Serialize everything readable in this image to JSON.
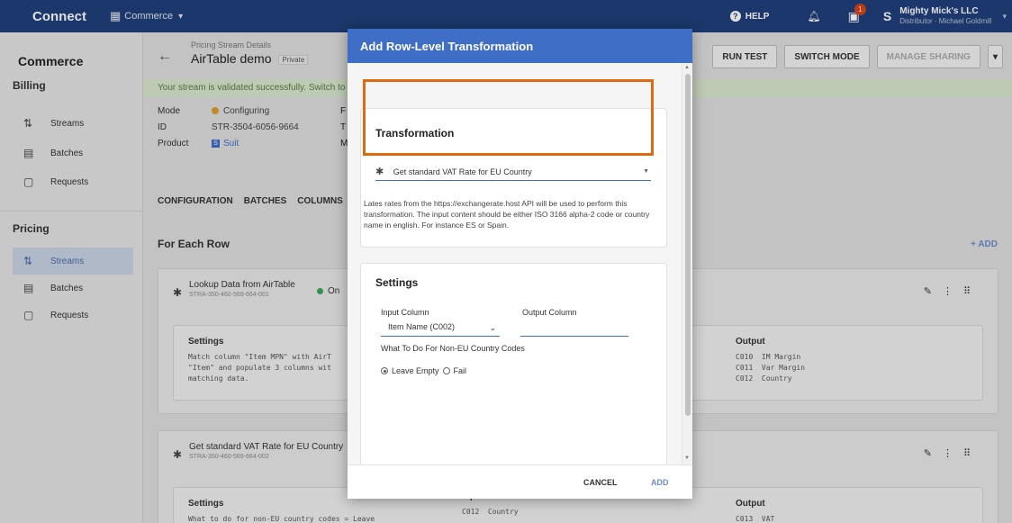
{
  "topbar": {
    "brand": "Connect",
    "module": "Commerce",
    "help": "HELP",
    "tasks_badge": "1",
    "account_initial": "S",
    "account_name": "Mighty Mick's LLC",
    "account_role": "Distributor · Michael Goldmill"
  },
  "sidebar": {
    "title": "Commerce",
    "sections": [
      {
        "label": "Billing",
        "items": [
          "Streams",
          "Batches",
          "Requests"
        ]
      },
      {
        "label": "Pricing",
        "items": [
          "Streams",
          "Batches",
          "Requests"
        ]
      }
    ]
  },
  "header": {
    "breadcrumb": "Pricing Stream Details",
    "title": "AirTable demo",
    "private": "Private",
    "actions": {
      "run_test": "RUN TEST",
      "switch_mode": "SWITCH MODE",
      "manage_sharing": "MANAGE SHARING"
    }
  },
  "banner": "Your stream is validated successfully. Switch to th",
  "details": {
    "mode_label": "Mode",
    "mode_value": "Configuring",
    "id_label": "ID",
    "id_value": "STR-3504-6056-9664",
    "product_label": "Product",
    "product_value": "Suit",
    "col_f": "F",
    "col_t": "T",
    "col_m": "M"
  },
  "tabs": [
    "CONFIGURATION",
    "BATCHES",
    "COLUMNS"
  ],
  "for_each_row": "For Each Row",
  "add_link": "+ ADD",
  "cards": [
    {
      "name": "Lookup Data from AirTable",
      "id": "STRA-350-460-569-664-001",
      "status": "On",
      "settings_title": "Settings",
      "settings_text": "Match column \"Item MPN\" with AirT\n\"Item\" and populate 3 columns wit\nmatching data.",
      "output_title": "Output",
      "output_text": "C010  IM Margin\nC011  Var Margin\nC012  Country"
    },
    {
      "name": "Get standard VAT Rate for EU Country",
      "id": "STRA-350-460-569-664-002",
      "settings_title": "Settings",
      "settings_text": "What to do for non-EU country codes = Leave",
      "input_title": "Input",
      "input_text": "C012  Country",
      "output_title": "Output",
      "output_text": "C013  VAT"
    }
  ],
  "modal": {
    "title": "Add Row-Level Transformation",
    "transformation_heading": "Transformation",
    "transformation_value": "Get standard VAT Rate for EU Country",
    "description": "Lates rates from the https://exchangerate.host API will be used to perform this transformation. The input content should be either ISO 3166 alpha-2 code or country name in english. For instance ES or Spain.",
    "settings_heading": "Settings",
    "input_column_label": "Input Column",
    "input_column_value": "Item Name (C002)",
    "output_column_label": "Output Column",
    "output_column_value": "",
    "non_eu_label": "What To Do For Non-EU Country Codes",
    "option_leave_empty": "Leave Empty",
    "option_fail": "Fail",
    "cancel": "CANCEL",
    "add": "ADD"
  },
  "colors": {
    "topbar": "#1f3f7a",
    "modal_header": "#3e6ec6",
    "highlight": "#e06a12",
    "link": "#6b8dc9"
  }
}
